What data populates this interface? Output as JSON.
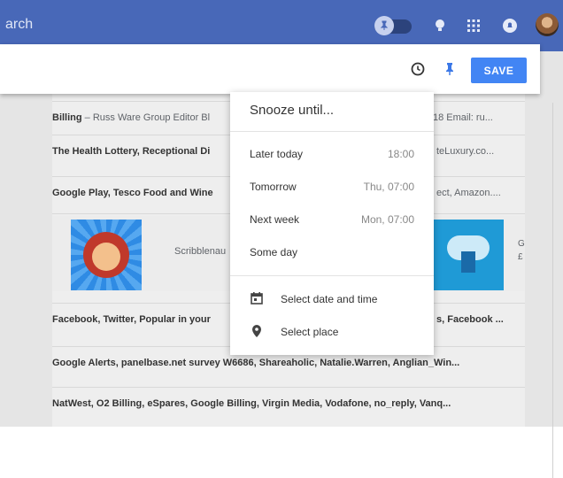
{
  "topbar": {
    "search_text": "arch",
    "icons": [
      "pin-icon",
      "bulb-icon",
      "apps-grid-icon",
      "notifications-icon"
    ]
  },
  "toolbar": {
    "save_label": "SAVE"
  },
  "rows": [
    {
      "sender": "Billing",
      "rest": " – Russ Ware Group Editor Bl",
      "tail": "18 Email: ru..."
    },
    {
      "sender": "The Health Lottery, Receptional Di",
      "rest": "",
      "tail": "teLuxury.co..."
    },
    {
      "sender": "Google Play, Tesco Food and Wine",
      "rest": "",
      "tail": "ect, Amazon...."
    },
    {
      "sender": "Facebook, Twitter, Popular in your",
      "rest": "",
      "tail": "s, Facebook ..."
    },
    {
      "sender": "Google Alerts, panelbase.net survey W6686, Shareaholic, Natalie.Warren, Anglian_Win...",
      "rest": "",
      "tail": ""
    },
    {
      "sender": "NatWest, O2 Billing, eSpares, Google Billing, Virgin Media, Vodafone, no_reply, Vanq...",
      "rest": "",
      "tail": ""
    }
  ],
  "card": {
    "text": "Scribblenau",
    "side1": "G",
    "side2": "£"
  },
  "snooze_menu": {
    "title": "Snooze until...",
    "items": [
      {
        "label": "Later today",
        "time": "18:00"
      },
      {
        "label": "Tomorrow",
        "time": "Thu, 07:00"
      },
      {
        "label": "Next week",
        "time": "Mon, 07:00"
      },
      {
        "label": "Some day",
        "time": ""
      }
    ],
    "extra": [
      {
        "label": "Select date and time",
        "icon": "calendar-icon"
      },
      {
        "label": "Select place",
        "icon": "place-pin-icon"
      }
    ]
  },
  "colors": {
    "topbar": "#4868b8",
    "save_button": "#4285f4",
    "pin_active": "#3b78e7"
  }
}
